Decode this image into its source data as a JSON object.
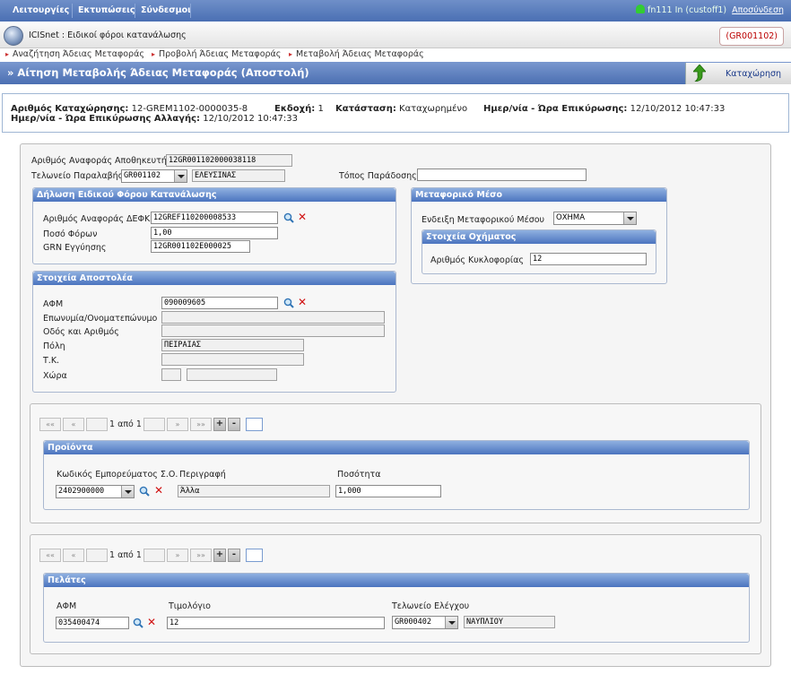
{
  "menu": {
    "items": [
      "Λειτουργίες",
      "Εκτυπώσεις",
      "Σύνδεσμοι"
    ]
  },
  "user": {
    "label": "fn111 In (custoff1)",
    "logout": "Αποσύνδεση"
  },
  "app": {
    "title": "ICISnet : Ειδικοί φόροι κατανάλωσης",
    "office": "(GR001102)"
  },
  "breadcrumbs": [
    "Αναζήτηση Άδειας Μεταφοράς",
    "Προβολή Άδειας Μεταφοράς",
    "Μεταβολή Άδειας Μεταφοράς"
  ],
  "page": {
    "title": "» Αίτηση Μεταβολής Άδειας Μεταφοράς (Αποστολή)",
    "save_label": "Καταχώρηση"
  },
  "info": {
    "reg_label": "Αριθμός Καταχώρησης:",
    "reg_value": "12-GREM1102-0000035-8",
    "version_label": "Εκδοχή:",
    "version_value": "1",
    "status_label": "Κατάσταση:",
    "status_value": "Καταχωρημένο",
    "valid_label": "Ημερ/νία - Ώρα Επικύρωσης:",
    "valid_value": "12/10/2012 10:47:33",
    "valid_change_label": "Ημερ/νία - Ώρα Επικύρωσης Αλλαγής:",
    "valid_change_value": "12/10/2012 10:47:33"
  },
  "header_fields": {
    "consignee_ref_label": "Αριθμός Αναφοράς Αποθηκευτή",
    "consignee_ref_value": "12GR001102000038118",
    "receiving_office_label": "Τελωνείο Παραλαβής",
    "receiving_office_code": "GR001102",
    "receiving_office_name": "ΕΛΕΥΣΙΝΑΣ",
    "delivery_place_label": "Τόπος Παράδοσης",
    "delivery_place_value": ""
  },
  "excise": {
    "title": "Δήλωση Ειδικού Φόρου Κατανάλωσης",
    "ref_label": "Αριθμός Αναφοράς ΔΕΦΚ",
    "ref_value": "12GREF110200008533",
    "amount_label": "Ποσό Φόρων",
    "amount_value": "1,00",
    "grn_label": "GRN Εγγύησης",
    "grn_value": "12GR001102E000025"
  },
  "transport": {
    "title": "Μεταφορικό Μέσο",
    "mode_label": "Ενδειξη Μεταφορικού Μέσου",
    "mode_value": "ΟΧΗΜΑ",
    "vehicle_title": "Στοιχεία Οχήματος",
    "plate_label": "Αριθμός Κυκλοφορίας",
    "plate_value": "12"
  },
  "sender": {
    "title": "Στοιχεία Αποστολέα",
    "afm_label": "ΑΦΜ",
    "afm_value": "090009605",
    "name_label": "Επωνυμία/Ονοματεπώνυμο",
    "name_value": "",
    "street_label": "Οδός και Αριθμός",
    "street_value": "",
    "city_label": "Πόλη",
    "city_value": "ΠΕΙΡΑΙΑΣ",
    "zip_label": "Τ.Κ.",
    "zip_value": "",
    "country_label": "Χώρα",
    "country_code": "",
    "country_name": ""
  },
  "pager1": {
    "first": "««",
    "prev": "«",
    "text": "1 από 1",
    "next": "»",
    "last": "»»",
    "plus": "+",
    "minus": "-"
  },
  "products": {
    "title": "Προϊόντα",
    "col_code": "Κωδικός Εμπορεύματος Σ.Ο.",
    "col_desc": "Περιγραφή",
    "col_qty": "Ποσότητα",
    "code_value": "2402900000",
    "desc_value": "Άλλα",
    "qty_value": "1,000"
  },
  "pager2": {
    "first": "««",
    "prev": "«",
    "text": "1 από 1",
    "next": "»",
    "last": "»»",
    "plus": "+",
    "minus": "-"
  },
  "customers": {
    "title": "Πελάτες",
    "col_afm": "ΑΦΜ",
    "col_invoice": "Τιμολόγιο",
    "col_office": "Τελωνείο Ελέγχου",
    "afm_value": "035400474",
    "invoice_value": "12",
    "office_code": "GR000402",
    "office_name": "ΝΑΥΠΛΙΟΥ"
  },
  "colors": {
    "header_blue": "#4b6fb2",
    "group_blue": "#4b74bf",
    "delete_red": "#d01010",
    "office_red": "#bb0000"
  }
}
